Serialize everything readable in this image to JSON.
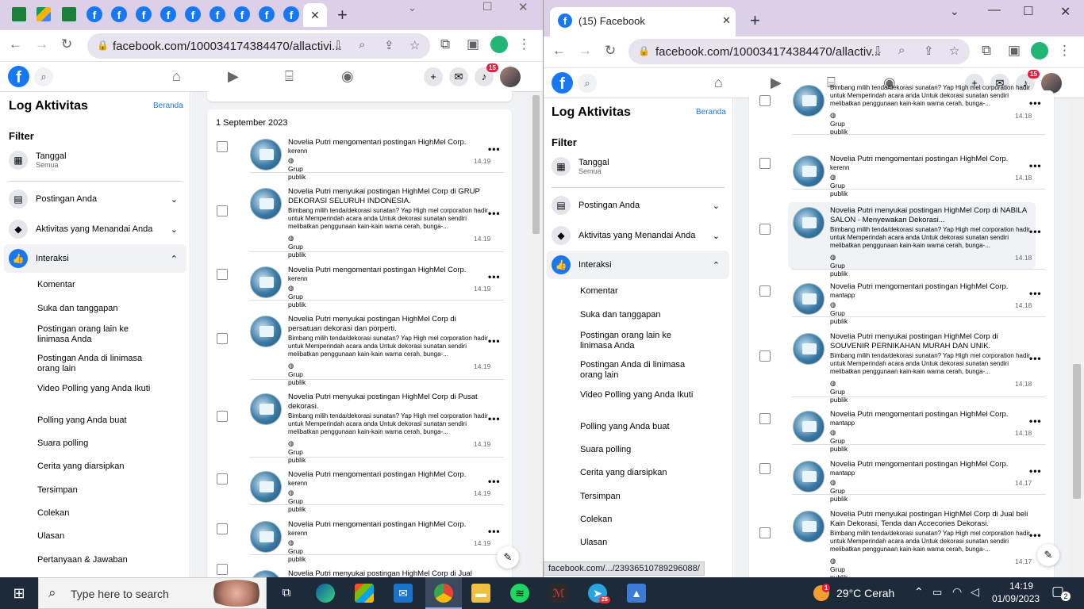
{
  "left_window": {
    "url": "facebook.com/100034174384470/allactivi...",
    "tab_close": "✕",
    "new_tab": "+",
    "status_url": "",
    "sidebar": {
      "title": "Log Aktivitas",
      "home_link": "Beranda",
      "filter_heading": "Filter",
      "date_filter": {
        "label": "Tanggal",
        "value": "Semua"
      },
      "sections": [
        {
          "label": "Postingan Anda",
          "expanded": false
        },
        {
          "label": "Aktivitas yang Menandai Anda",
          "expanded": false
        },
        {
          "label": "Interaksi",
          "expanded": true
        }
      ],
      "sub_items": [
        "Komentar",
        "Suka dan tanggapan",
        "Postingan orang lain ke linimasa Anda",
        "Postingan Anda di linimasa orang lain",
        "Video Polling yang Anda Ikuti",
        "Polling yang Anda buat",
        "Suara polling",
        "Cerita yang diarsipkan",
        "Tersimpan",
        "Colekan",
        "Ulasan",
        "Pertanyaan & Jawaban"
      ]
    },
    "date_header": "1 September 2023",
    "entries": [
      {
        "title": "Novelia Putri mengomentari postingan HighMel Corp.",
        "extra": "kerenn",
        "desc": "",
        "privacy": "Grup publik",
        "time": "14.19"
      },
      {
        "title": "Novelia Putri menyukai postingan HighMel Corp di GRUP DEKORASI SELURUH INDONESIA.",
        "extra": "",
        "desc": "Bimbang milih tenda/dekorasi sunatan? Yap High mel corporation hadir untuk Memperindah acara anda Untuk dekorasi sunatan sendiri melibatkan penggunaan kain-kain warna cerah, bunga-...",
        "privacy": "Grup publik",
        "time": "14.19"
      },
      {
        "title": "Novelia Putri mengomentari postingan HighMel Corp.",
        "extra": "kerenn",
        "desc": "",
        "privacy": "Grup publik",
        "time": "14.19"
      },
      {
        "title": "Novelia Putri menyukai postingan HighMel Corp di persatuan dekorasi dan porperti.",
        "extra": "",
        "desc": "Bimbang milih tenda/dekorasi sunatan? Yap High mel corporation hadir untuk Memperindah acara anda Untuk dekorasi sunatan sendiri melibatkan penggunaan kain-kain warna cerah, bunga-...",
        "privacy": "Grup publik",
        "time": "14.19"
      },
      {
        "title": "Novelia Putri menyukai postingan HighMel Corp di Pusat dekorasi.",
        "extra": "",
        "desc": "Bimbang milih tenda/dekorasi sunatan? Yap High mel corporation hadir untuk Memperindah acara anda Untuk dekorasi sunatan sendiri melibatkan penggunaan kain-kain warna cerah, bunga-...",
        "privacy": "Grup publik",
        "time": "14.19"
      },
      {
        "title": "Novelia Putri mengomentari postingan HighMel Corp.",
        "extra": "kerenn",
        "desc": "",
        "privacy": "Grup publik",
        "time": "14.19"
      },
      {
        "title": "Novelia Putri mengomentari postingan HighMel Corp.",
        "extra": "kerenn",
        "desc": "",
        "privacy": "Grup publik",
        "time": "14.19"
      },
      {
        "title": "Novelia Putri menyukai postingan HighMel Corp di Jual",
        "extra": "",
        "desc": "",
        "privacy": "",
        "time": ""
      }
    ],
    "notif_count": "15"
  },
  "right_window": {
    "tab_title": "(15) Facebook",
    "tab_close": "✕",
    "new_tab": "+",
    "url": "facebook.com/100034174384470/allactiv...",
    "status_url": "facebook.com/.../23936510789296088/",
    "sidebar": {
      "title": "Log Aktivitas",
      "home_link": "Beranda",
      "filter_heading": "Filter",
      "date_filter": {
        "label": "Tanggal",
        "value": "Semua"
      },
      "sections": [
        {
          "label": "Postingan Anda",
          "expanded": false
        },
        {
          "label": "Aktivitas yang Menandai Anda",
          "expanded": false
        },
        {
          "label": "Interaksi",
          "expanded": true
        }
      ],
      "sub_items": [
        "Komentar",
        "Suka dan tanggapan",
        "Postingan orang lain ke linimasa Anda",
        "Postingan Anda di linimasa orang lain",
        "Video Polling yang Anda Ikuti",
        "Polling yang Anda buat",
        "Suara polling",
        "Cerita yang diarsipkan",
        "Tersimpan",
        "Colekan",
        "Ulasan"
      ]
    },
    "entries": [
      {
        "title": "",
        "extra": "",
        "desc": "Bimbang milih tenda/dekorasi sunatan? Yap High mel corporation hadir untuk Memperindah acara anda Untuk dekorasi sunatan sendiri melibatkan penggunaan kain-kain warna cerah, bunga-...",
        "privacy": "Grup publik",
        "time": "14.18"
      },
      {
        "title": "Novelia Putri mengomentari postingan HighMel Corp.",
        "extra": "kerenn",
        "desc": "",
        "privacy": "Grup publik",
        "time": "14.18"
      },
      {
        "title": "Novelia Putri menyukai postingan HighMel Corp di NABILA SALON - Menyewakan Dekorasi...",
        "extra": "",
        "desc": "Bimbang milih tenda/dekorasi sunatan? Yap High mel corporation hadir untuk Memperindah acara anda Untuk dekorasi sunatan sendiri melibatkan penggunaan kain-kain warna cerah, bunga-...",
        "privacy": "Grup publik",
        "time": "14.18"
      },
      {
        "title": "Novelia Putri mengomentari postingan HighMel Corp.",
        "extra": "mantapp",
        "desc": "",
        "privacy": "Grup publik",
        "time": "14.18"
      },
      {
        "title": "Novelia Putri menyukai postingan HighMel Corp di SOUVENIR PERNIKAHAN MURAH DAN UNIK.",
        "extra": "",
        "desc": "Bimbang milih tenda/dekorasi sunatan? Yap High mel corporation hadir untuk Memperindah acara anda Untuk dekorasi sunatan sendiri melibatkan penggunaan kain-kain warna cerah, bunga-...",
        "privacy": "Grup publik",
        "time": "14.18"
      },
      {
        "title": "Novelia Putri mengomentari postingan HighMel Corp.",
        "extra": "mantapp",
        "desc": "",
        "privacy": "Grup publik",
        "time": "14.18"
      },
      {
        "title": "Novelia Putri mengomentari postingan HighMel Corp.",
        "extra": "mantapp",
        "desc": "",
        "privacy": "Grup publik",
        "time": "14.17"
      },
      {
        "title": "Novelia Putri menyukai postingan HighMel Corp di Jual beli Kain Dekorasi, Tenda dan Accecories Dekorasi.",
        "extra": "",
        "desc": "Bimbang milih tenda/dekorasi sunatan? Yap High mel corporation hadir untuk Memperindah acara anda Untuk dekorasi sunatan sendiri melibatkan penggunaan kain-kain warna cerah, bunga-...",
        "privacy": "Grup publik",
        "time": "14.17"
      }
    ],
    "notif_count": "15"
  },
  "taskbar": {
    "search_placeholder": "Type here to search",
    "weather": "29°C  Cerah",
    "time": "14:19",
    "date": "01/09/2023",
    "notif_count": "2",
    "telegram_badge": "25",
    "weather_badge": "1"
  },
  "colors": {
    "fb_blue": "#1877f2",
    "tabbar": "#dcd0e8",
    "omnibox": "#e9e3ef",
    "taskbar": "#1c2a3a"
  }
}
